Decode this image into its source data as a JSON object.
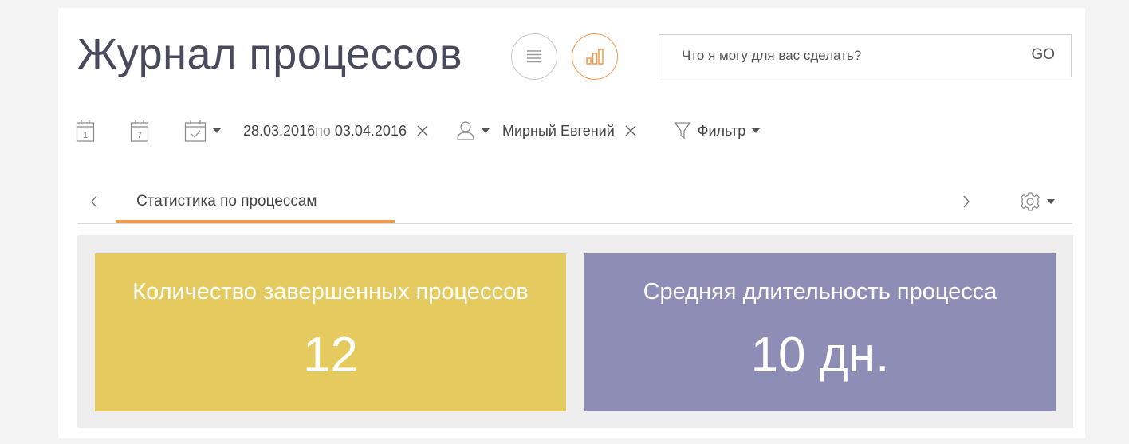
{
  "header": {
    "title": "Журнал процессов",
    "view_list_icon": "list-icon",
    "view_chart_icon": "bar-chart-icon",
    "accent_color": "#f29a4a"
  },
  "search": {
    "placeholder": "Что я могу для вас сделать?",
    "go_label": "GO"
  },
  "filters": {
    "day_icon_number": "1",
    "week_icon_number": "7",
    "date_from": "28.03.2016",
    "date_connector": "по",
    "date_to": "03.04.2016",
    "user_name": "Мирный Евгений",
    "filter_label": "Фильтр"
  },
  "tabs": {
    "active_label": "Статистика по процессам"
  },
  "dashboard": {
    "tiles": [
      {
        "caption": "Количество завершенных процессов",
        "value": "12",
        "color": "#e5cb5f"
      },
      {
        "caption": "Средняя длительность процесса",
        "value": "10 дн.",
        "color": "#8e8db5"
      }
    ]
  }
}
